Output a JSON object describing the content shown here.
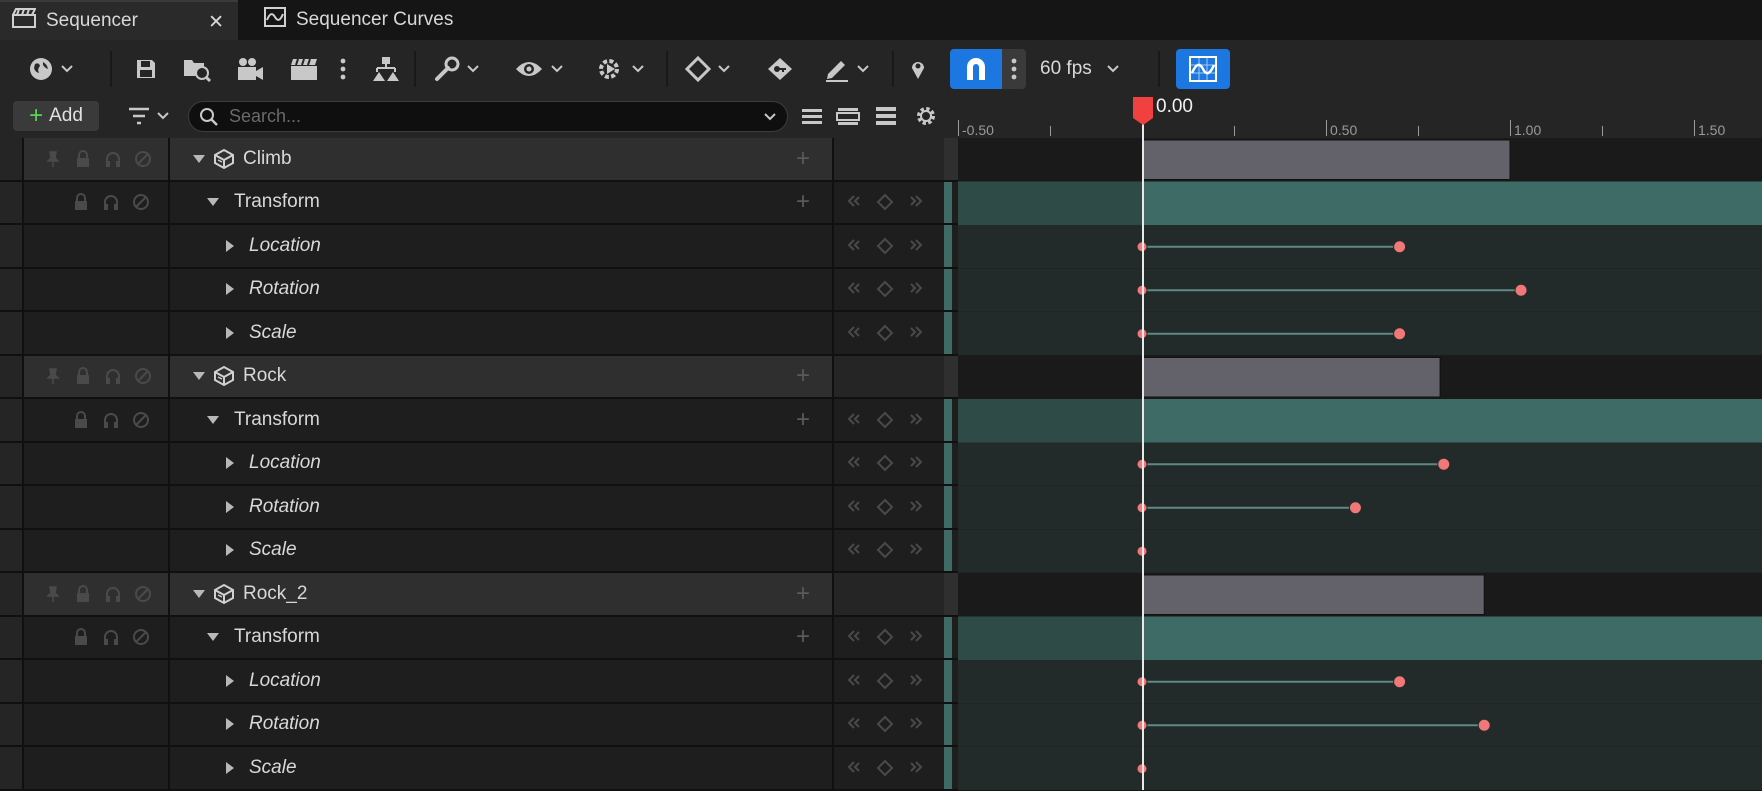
{
  "tabs": [
    {
      "label": "Sequencer",
      "icon": "clapper-icon",
      "active": true
    },
    {
      "label": "Sequencer Curves",
      "icon": "curve-graph-icon",
      "active": false
    }
  ],
  "toolbar": {
    "fps_label": "60 fps"
  },
  "filter_bar": {
    "add_label": "Add",
    "search_placeholder": "Search..."
  },
  "timeline": {
    "ruler_labels": [
      "-0.50",
      "0.50",
      "1.00",
      "1.50"
    ],
    "playhead_label": "0.00",
    "colors": {
      "section": "#63626a",
      "transform_band": "#3f6b66",
      "key": "#f07878",
      "playhead": "#f04040"
    }
  },
  "tracks": [
    {
      "name": "Climb",
      "section_end": 1.0,
      "transform_label": "Transform",
      "channels": [
        {
          "label": "Location",
          "key_end": 0.7
        },
        {
          "label": "Rotation",
          "key_end": 1.03
        },
        {
          "label": "Scale",
          "key_end": 0.7
        }
      ]
    },
    {
      "name": "Rock",
      "section_end": 0.81,
      "transform_label": "Transform",
      "channels": [
        {
          "label": "Location",
          "key_end": 0.82
        },
        {
          "label": "Rotation",
          "key_end": 0.58
        },
        {
          "label": "Scale",
          "key_end": null
        }
      ]
    },
    {
      "name": "Rock_2",
      "section_end": 0.93,
      "transform_label": "Transform",
      "channels": [
        {
          "label": "Location",
          "key_end": 0.7
        },
        {
          "label": "Rotation",
          "key_end": 0.93
        },
        {
          "label": "Scale",
          "key_end": null
        }
      ]
    }
  ]
}
